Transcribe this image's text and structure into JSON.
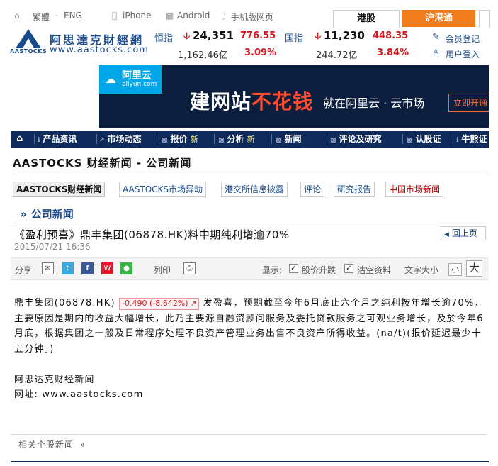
{
  "topbar": {
    "lang_trad": "繁體",
    "lang_eng": "ENG",
    "iphone": "iPhone",
    "android": "Android",
    "mobile_web": "手机版网页",
    "tab_hk": "港股",
    "tab_hsh": "沪港通"
  },
  "brand": {
    "logo_text": "AASTOCKS",
    "name": "阿思達克財經網",
    "url": "www.aastocks.com"
  },
  "indices": {
    "hsi": {
      "label": "恒指",
      "value": "24,351",
      "change": "776.55",
      "turnover": "1,162.46亿",
      "pct": "3.09%"
    },
    "hsce": {
      "label": "国指",
      "value": "11,230",
      "change": "448.35",
      "turnover": "244.72亿",
      "pct": "3.84%"
    }
  },
  "member": {
    "register": "会员登记",
    "login": "用户登入"
  },
  "ad": {
    "logo": "阿里云",
    "logo_sub": "aliyun.com",
    "headline_a": "建网站",
    "headline_b": "不花钱",
    "sub": "就在阿里云 · 云市场",
    "cta": "立即开通"
  },
  "nav": {
    "items": [
      {
        "label": "产品资讯",
        "badge": ""
      },
      {
        "label": "市场动态",
        "badge": ""
      },
      {
        "label": "报价",
        "badge": "新"
      },
      {
        "label": "分析",
        "badge": "新"
      },
      {
        "label": "新闻",
        "badge": ""
      },
      {
        "label": "评论及研究",
        "badge": ""
      },
      {
        "label": "认股证",
        "badge": ""
      },
      {
        "label": "牛熊证",
        "badge": ""
      }
    ]
  },
  "page": {
    "title": "AASTOCKS 财经新闻 - 公司新闻",
    "subtabs": [
      "AASTOCKS财经新闻",
      "AASTOCKS市场异动",
      "港交所信息披露",
      "评论",
      "研究报告",
      "中国市场新闻"
    ],
    "section": "公司新闻",
    "headline": "《盈利预喜》鼎丰集团(06878.HK)料中期纯利增逾70%",
    "back": "回上页",
    "timestamp": "2015/07/21 16:36"
  },
  "share": {
    "label": "分享",
    "print": "列印",
    "display": "显示:",
    "opt_price": "股价升跌",
    "opt_info": "沽空资料",
    "font_size": "文字大小",
    "font_small": "小",
    "font_large": "大"
  },
  "article": {
    "lead": "鼎丰集团(06878.HK)",
    "change": "-0.490 (-8.642%)",
    "text": "发盈喜，预期截至今年6月底止六个月之纯利按年增长逾70%，主要原因是期内的收益大幅增长，此乃主要源自融资顾问服务及委托贷款服务之可观业务增长，及於今年6月底，根据集团之一般及日常程序处理不良资产管理业务出售不良资产所得收益。(na/t)(报价延迟最少十五分钟。)",
    "source": "阿思达克财经新闻",
    "url": "网址: www.aastocks.com"
  },
  "related": "相关个股新闻",
  "colors": {
    "navy": "#0e2a5a",
    "orange": "#f07c1b",
    "red": "#d71920",
    "link": "#1a4b8c"
  }
}
